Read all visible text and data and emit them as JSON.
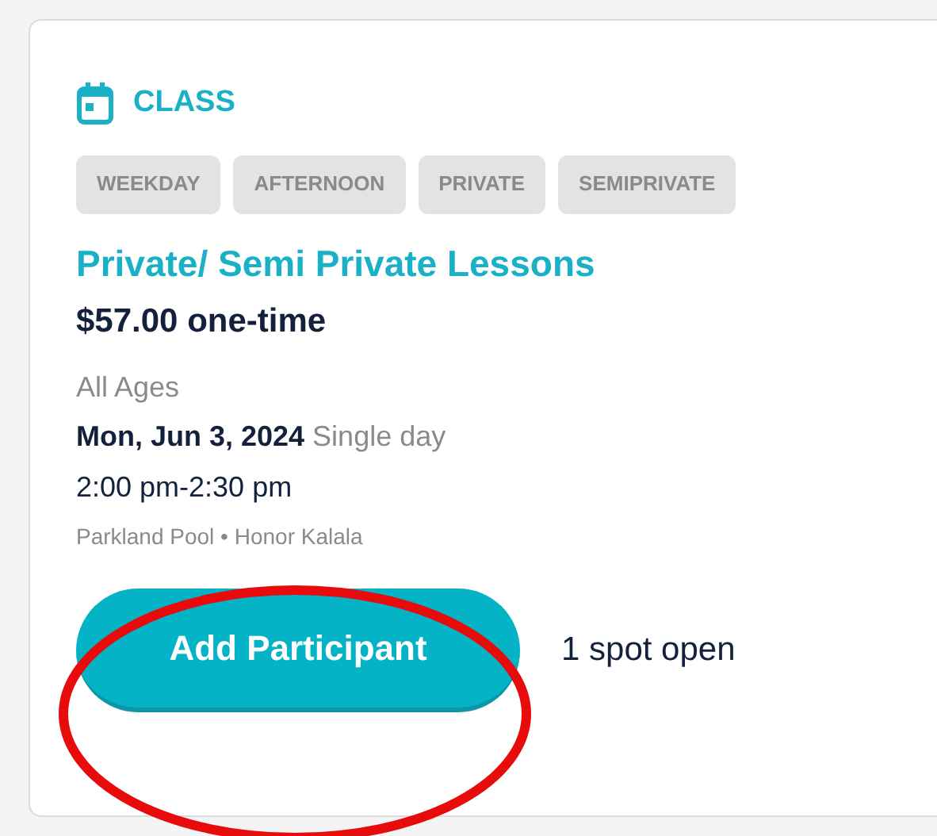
{
  "category": {
    "label": "CLASS"
  },
  "tags": [
    "WEEKDAY",
    "AFTERNOON",
    "PRIVATE",
    "SEMIPRIVATE"
  ],
  "title": "Private/ Semi Private Lessons",
  "price": "$57.00 one-time",
  "ages": "All Ages",
  "date": {
    "day": "Mon, Jun 3, 2024",
    "note": "Single day"
  },
  "time": "2:00 pm-2:30 pm",
  "location": "Parkland Pool • Honor Kalala",
  "action": {
    "label": "Add Participant",
    "availability": "1 spot open"
  },
  "annotation": {
    "kind": "ellipse"
  }
}
